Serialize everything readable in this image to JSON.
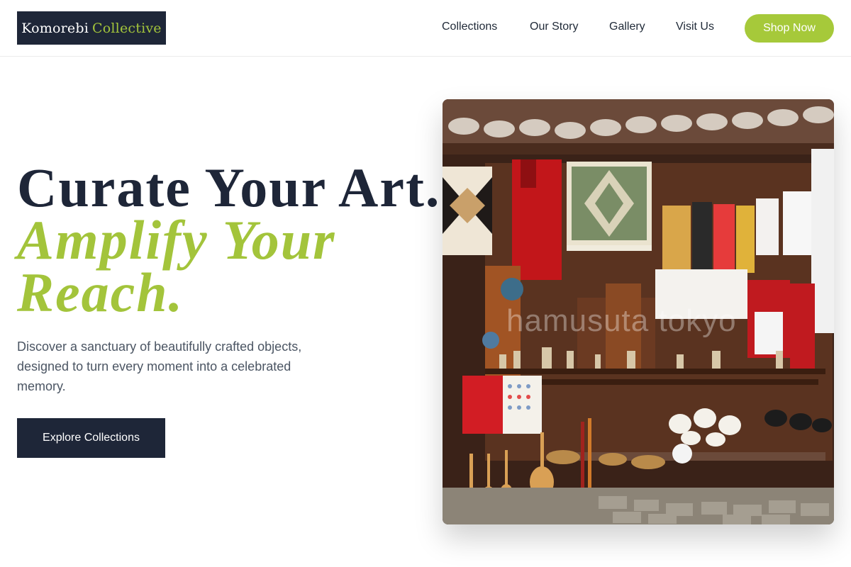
{
  "brand": {
    "name_part1": "Komorebi",
    "name_part2": "Collective"
  },
  "nav": {
    "items": [
      {
        "label": "Collections"
      },
      {
        "label": "Our Story"
      },
      {
        "label": "Gallery"
      },
      {
        "label": "Visit Us"
      }
    ],
    "cta_label": "Shop Now"
  },
  "hero": {
    "headline_line1": "Curate Your Art.",
    "headline_line2": "Amplify Your",
    "headline_line3": "Reach.",
    "description": "Discover a sanctuary of beautifully crafted objects, designed to turn every moment into a celebrated memory.",
    "cta_label": "Explore Collections",
    "image_watermark": "hamusuta tokyo"
  },
  "colors": {
    "primary_navy": "#1e2638",
    "accent_green": "#a3c43b",
    "button_green": "#a6c93a",
    "body_text": "#4b5563"
  }
}
